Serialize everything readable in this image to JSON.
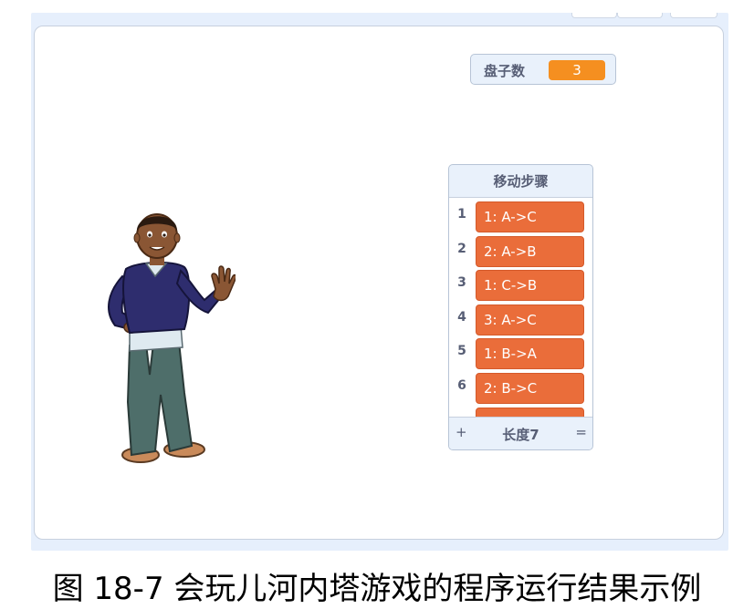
{
  "variable_monitor": {
    "label": "盘子数",
    "value": "3"
  },
  "list_monitor": {
    "title": "移动步骤",
    "rows": [
      {
        "index": "1",
        "value": "1: A->C"
      },
      {
        "index": "2",
        "value": "2: A->B"
      },
      {
        "index": "3",
        "value": "1: C->B"
      },
      {
        "index": "4",
        "value": "3: A->C"
      },
      {
        "index": "5",
        "value": "1: B->A"
      },
      {
        "index": "6",
        "value": "2: B->C"
      }
    ],
    "add_symbol": "+",
    "length_label": "长度7",
    "resize_symbol": "="
  },
  "caption": "图 18-7 会玩儿河内塔游戏的程序运行结果示例",
  "colors": {
    "variable_value_bg": "#f58f20",
    "list_item_bg": "#ea6d3a",
    "monitor_bg": "#e9f1fb",
    "monitor_text": "#575e75"
  },
  "icons": {
    "sprite": "boy-character-waving"
  }
}
